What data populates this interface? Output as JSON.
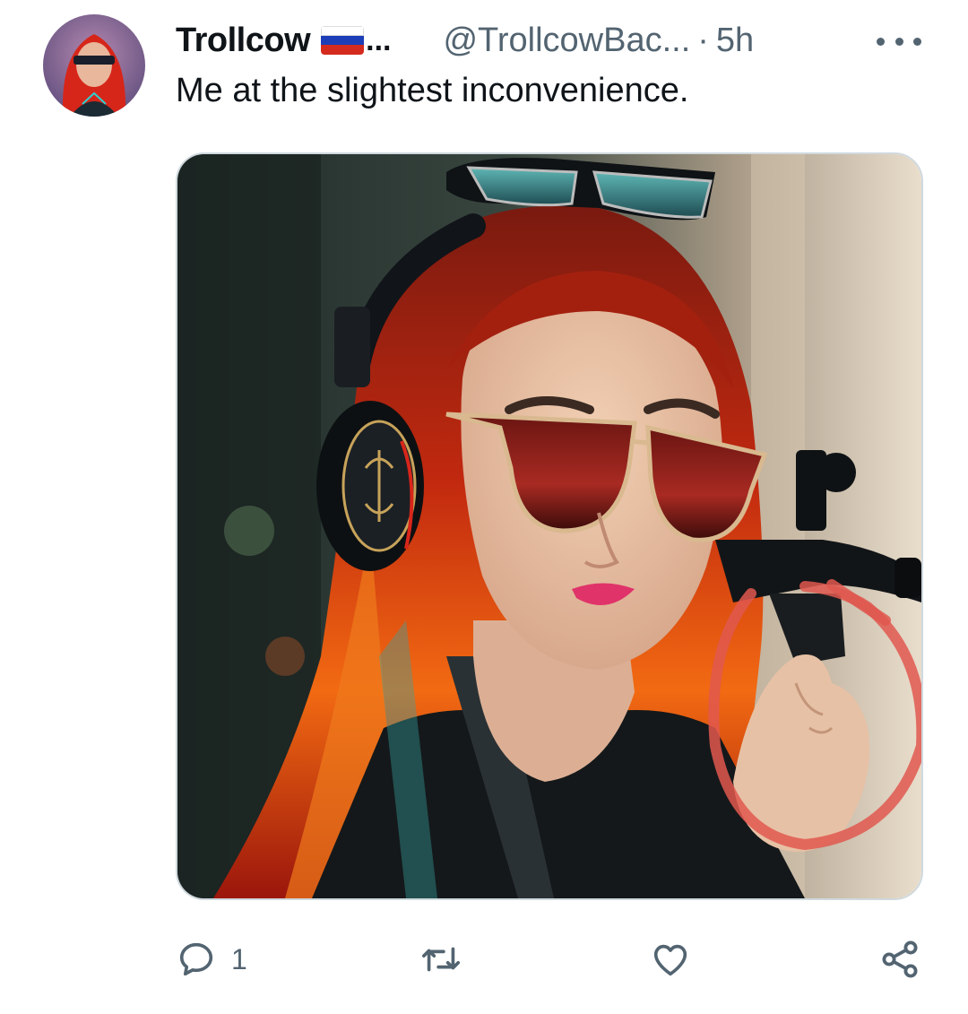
{
  "author": {
    "display_name": "Trollcow",
    "flag_icon": "russia-flag-icon",
    "name_ellipsis": "...",
    "handle": "@TrollcowBac...",
    "separator": "·",
    "time": "5h"
  },
  "tweet": {
    "text": "Me at the slightest inconvenience."
  },
  "actions": {
    "reply_count": "1",
    "icons": [
      "reply-icon",
      "retweet-icon",
      "like-icon",
      "share-icon"
    ]
  },
  "colors": {
    "secondary_text": "#536471",
    "primary_text": "#0f1419",
    "annotation_circle": "#e0584f"
  }
}
